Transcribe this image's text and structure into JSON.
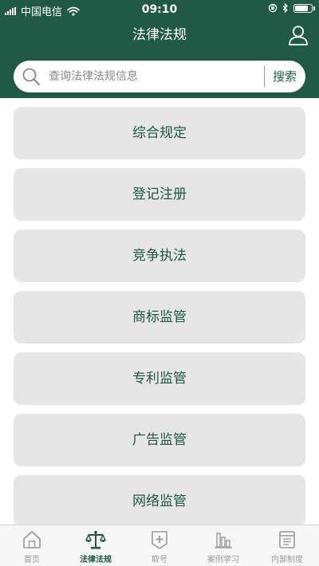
{
  "status_bar": {
    "carrier": "中国电信",
    "time": "09:10",
    "battery_level": 0.85
  },
  "header": {
    "title": "法律法规"
  },
  "search": {
    "placeholder": "查询法律法规信息",
    "value": "",
    "button_label": "搜索"
  },
  "categories": [
    {
      "label": "综合规定"
    },
    {
      "label": "登记注册"
    },
    {
      "label": "竞争执法"
    },
    {
      "label": "商标监管"
    },
    {
      "label": "专利监管"
    },
    {
      "label": "广告监管"
    },
    {
      "label": "网络监管"
    }
  ],
  "tabs": [
    {
      "label": "首页",
      "icon": "home-icon",
      "active": false
    },
    {
      "label": "法律法规",
      "icon": "scales-icon",
      "active": true
    },
    {
      "label": "取号",
      "icon": "ticket-icon",
      "active": false
    },
    {
      "label": "案例学习",
      "icon": "chart-icon",
      "active": false
    },
    {
      "label": "内部制度",
      "icon": "document-icon",
      "active": false
    }
  ],
  "colors": {
    "brand_green": "#1e5a46",
    "tab_inactive": "#9a9a9a",
    "item_background": "#e6e6e6"
  }
}
